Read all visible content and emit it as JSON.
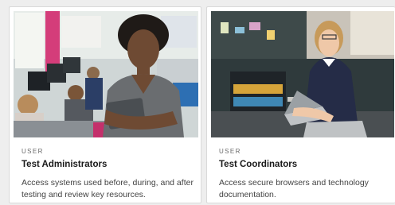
{
  "cards": [
    {
      "eyebrow": "USER",
      "title": "Test Administrators",
      "description": "Access systems used before, during, and after testing and review key resources.",
      "image": "photo-woman-in-computer-lab-holding-tablet"
    },
    {
      "eyebrow": "USER",
      "title": "Test Coordinators",
      "description": "Access secure browsers and technology documentation.",
      "image": "photo-woman-with-laptop-in-classroom"
    }
  ],
  "colors": {
    "card_background": "#ffffff",
    "page_background": "#eeeeee",
    "title_text": "#1a1a1a",
    "body_text": "#444444",
    "eyebrow_text": "#6b6b6b"
  }
}
